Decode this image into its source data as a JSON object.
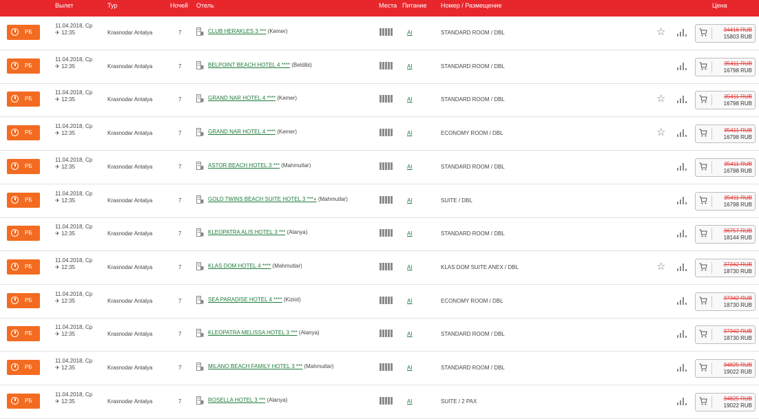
{
  "header": {
    "departure": "Вылет",
    "tour": "Тур",
    "nights": "Ночей",
    "hotel": "Отель",
    "seats": "Места",
    "meal": "Питание",
    "room": "Номер / Размещение",
    "price": "Цена"
  },
  "colors": {
    "header_bg": "#e8272d",
    "rb_button": "#f36b21",
    "hotel_link": "#1e7a3a",
    "old_price": "#e23a3a"
  },
  "rows": [
    {
      "rb": "РБ",
      "date": "11.04.2018, Ср",
      "time": "12:35",
      "route": "Krasnodar Antalya",
      "nights": "7",
      "hotel": "CLUB HERAKLES 3 ***",
      "region": "(Kemer)",
      "meal": "AI",
      "room": "STANDARD ROOM / DBL",
      "fav": true,
      "old_price": "34416 RUB",
      "new_price": "15803 RUB"
    },
    {
      "rb": "РБ",
      "date": "11.04.2018, Ср",
      "time": "12:35",
      "route": "Krasnodar Antalya",
      "nights": "7",
      "hotel": "BELPOINT BEACH HOTEL 4 ****",
      "region": "(Beldibi)",
      "meal": "AI",
      "room": "STANDARD ROOM / DBL",
      "fav": false,
      "old_price": "35411 RUB",
      "new_price": "16798 RUB"
    },
    {
      "rb": "РБ",
      "date": "11.04.2018, Ср",
      "time": "12:35",
      "route": "Krasnodar Antalya",
      "nights": "7",
      "hotel": "GRAND NAR HOTEL 4 ****",
      "region": "(Kemer)",
      "meal": "AI",
      "room": "STANDARD ROOM / DBL",
      "fav": true,
      "old_price": "35411 RUB",
      "new_price": "16798 RUB"
    },
    {
      "rb": "РБ",
      "date": "11.04.2018, Ср",
      "time": "12:35",
      "route": "Krasnodar Antalya",
      "nights": "7",
      "hotel": "GRAND NAR HOTEL 4 ****",
      "region": "(Kemer)",
      "meal": "AI",
      "room": "ECONOMY ROOM / DBL",
      "fav": true,
      "old_price": "35411 RUB",
      "new_price": "16798 RUB"
    },
    {
      "rb": "РБ",
      "date": "11.04.2018, Ср",
      "time": "12:35",
      "route": "Krasnodar Antalya",
      "nights": "7",
      "hotel": "ASTOR BEACH HOTEL 3 ***",
      "region": "(Mahmutlar)",
      "meal": "AI",
      "room": "STANDARD ROOM / DBL",
      "fav": false,
      "old_price": "35411 RUB",
      "new_price": "16798 RUB"
    },
    {
      "rb": "РБ",
      "date": "11.04.2018, Ср",
      "time": "12:35",
      "route": "Krasnodar Antalya",
      "nights": "7",
      "hotel": "GOLD TWINS BEACH SUITE HOTEL 3 ***+",
      "region": "(Mahmutlar)",
      "meal": "AI",
      "room": "SUITE / DBL",
      "fav": false,
      "old_price": "35411 RUB",
      "new_price": "16798 RUB"
    },
    {
      "rb": "РБ",
      "date": "11.04.2018, Ср",
      "time": "12:35",
      "route": "Krasnodar Antalya",
      "nights": "7",
      "hotel": "KLEOPATRA ALIS HOTEL 3 ***",
      "region": "(Alanya)",
      "meal": "AI",
      "room": "STANDARD ROOM / DBL",
      "fav": false,
      "old_price": "36757 RUB",
      "new_price": "18144 RUB"
    },
    {
      "rb": "РБ",
      "date": "11.04.2018, Ср",
      "time": "12:35",
      "route": "Krasnodar Antalya",
      "nights": "7",
      "hotel": "KLAS DOM HOTEL 4 ****",
      "region": "(Mahmutlar)",
      "meal": "AI",
      "room": "KLAS DOM SUITE ANEX / DBL",
      "fav": true,
      "old_price": "37342 RUB",
      "new_price": "18730 RUB"
    },
    {
      "rb": "РБ",
      "date": "11.04.2018, Ср",
      "time": "12:35",
      "route": "Krasnodar Antalya",
      "nights": "7",
      "hotel": "SEA PARADISE HOTEL 4 ****",
      "region": "(Kiziot)",
      "meal": "AI",
      "room": "ECONOMY ROOM / DBL",
      "fav": false,
      "old_price": "37342 RUB",
      "new_price": "18730 RUB"
    },
    {
      "rb": "РБ",
      "date": "11.04.2018, Ср",
      "time": "12:35",
      "route": "Krasnodar Antalya",
      "nights": "7",
      "hotel": "KLEOPATRA MELISSA HOTEL 3 ***",
      "region": "(Alanya)",
      "meal": "AI",
      "room": "STANDARD ROOM / DBL",
      "fav": false,
      "old_price": "37342 RUB",
      "new_price": "18730 RUB"
    },
    {
      "rb": "РБ",
      "date": "11.04.2018, Ср",
      "time": "12:35",
      "route": "Krasnodar Antalya",
      "nights": "7",
      "hotel": "MILANO BEACH FAMILY HOTEL 3 ***",
      "region": "(Mahmutlar)",
      "meal": "AI",
      "room": "STANDARD ROOM / DBL",
      "fav": false,
      "old_price": "34825 RUB",
      "new_price": "19022 RUB"
    },
    {
      "rb": "РБ",
      "date": "11.04.2018, Ср",
      "time": "12:35",
      "route": "Krasnodar Antalya",
      "nights": "7",
      "hotel": "ROSELLA HOTEL 3 ***",
      "region": "(Alanya)",
      "meal": "AI",
      "room": "SUITE / 2 PAX",
      "fav": false,
      "old_price": "34825 RUB",
      "new_price": "19022 RUB"
    }
  ]
}
